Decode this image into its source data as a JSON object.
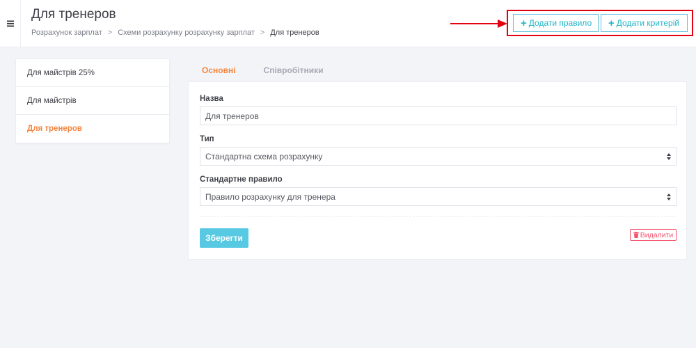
{
  "header": {
    "title": "Для тренеров",
    "breadcrumb": {
      "items": [
        "Розрахунок зарплат",
        "Схеми розрахунку розрахунку зарплат",
        "Для тренеров"
      ],
      "separator": ">"
    },
    "actions": {
      "add_rule_label": "Додати правило",
      "add_criterion_label": "Додати критерій",
      "plus_icon": "+"
    },
    "menu_icon": "hamburger-icon"
  },
  "sidebar": {
    "items": [
      {
        "label": "Для майстрів 25%",
        "active": false
      },
      {
        "label": "Для майстрів",
        "active": false
      },
      {
        "label": "Для тренеров",
        "active": true
      }
    ]
  },
  "tabs": [
    {
      "label": "Основні",
      "active": true
    },
    {
      "label": "Співробітники",
      "active": false
    }
  ],
  "form": {
    "name": {
      "label": "Назва",
      "value": "Для тренеров"
    },
    "type": {
      "label": "Тип",
      "value": "Стандартна схема розрахунку"
    },
    "default_rule": {
      "label": "Стандартне правило",
      "value": "Правило розрахунку для тренера"
    },
    "save_label": "Зберегти",
    "delete_label": "Видалити"
  },
  "colors": {
    "accent": "#f4853e",
    "primary": "#58c9e2",
    "danger": "#f4516c",
    "annotation_red": "#e3000f"
  }
}
